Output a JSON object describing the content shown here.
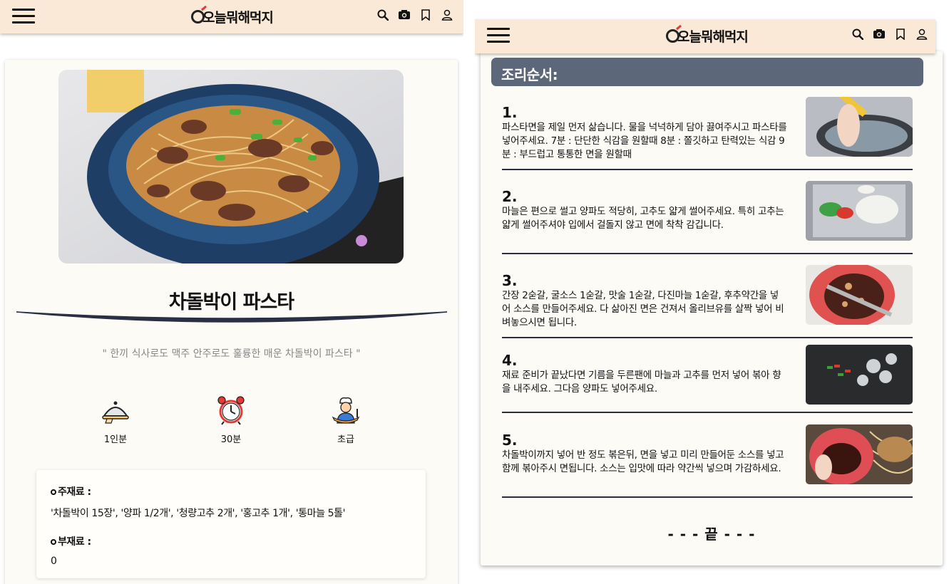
{
  "app": {
    "logo_text": "오늘뭐해먹지"
  },
  "recipe": {
    "title": "차돌박이 파스타",
    "subtitle": "\" 한끼 식사로도 맥주 안주로도 훌륭한 매운 차돌박이 파스타 \"",
    "info": [
      {
        "icon": "serving-dish-icon",
        "label": "1인분"
      },
      {
        "icon": "alarm-clock-icon",
        "label": "30분"
      },
      {
        "icon": "chef-icon",
        "label": "초급"
      }
    ],
    "ingredients": {
      "main_label": "주재료 :",
      "main_text": "'차돌박이 15장', '양파 1/2개', '청량고추 2개', '홍고추 1개', '통마늘 5톨'",
      "sub_label": "부재료 :",
      "sub_text": "0"
    }
  },
  "steps_section": {
    "title": "조리순서:",
    "steps": [
      {
        "num": "1.",
        "text": "파스타면을 제일 먼저 삶습니다. 물을 넉넉하게 담아 끓여주시고 파스타를 넣어주세요. 7분 : 단단한 식감을 원할때 8분 : 쫄깃하고 탄력있는 식감 9분 : 부드럽고 통통한 면을 원할때"
      },
      {
        "num": "2.",
        "text": "마늘은 편으로 썰고 양파도 적당히, 고추도 얇게 썰어주세요. 특히 고추는 얇게 썰어주셔야 입에서 걸돌지 않고 면에 착착 감깁니다."
      },
      {
        "num": "3.",
        "text": "간장 2숟갈, 굴소스 1숟갈, 맛술 1숟갈, 다진마늘 1숟갈, 후추약간을 넣어 소스를 만들어주세요. 다 삶아진 면은 건져서 올리브유를 살짝 넣어 비벼놓으시면 됩니다."
      },
      {
        "num": "4.",
        "text": "재료 준비가 끝났다면 기름을 두른팬에 마늘과 고추를 먼저 넣어 볶아 향을 내주세요. 그다음 양파도 넣어주세요."
      },
      {
        "num": "5.",
        "text": "차돌박이까지 넣어 반 정도 볶은뒤, 면을 넣고 미리 만들어둔 소스를 넣고 함께 볶아주시 면됩니다. 소스는 입맛에 따라 약간씩 넣으며 가감하세요."
      }
    ],
    "end_text": "- - - 끝 - - -"
  },
  "colors": {
    "header_bg": "#fbe9d7",
    "section_bar": "#5c6779",
    "card_bg": "#fdfbf6"
  }
}
